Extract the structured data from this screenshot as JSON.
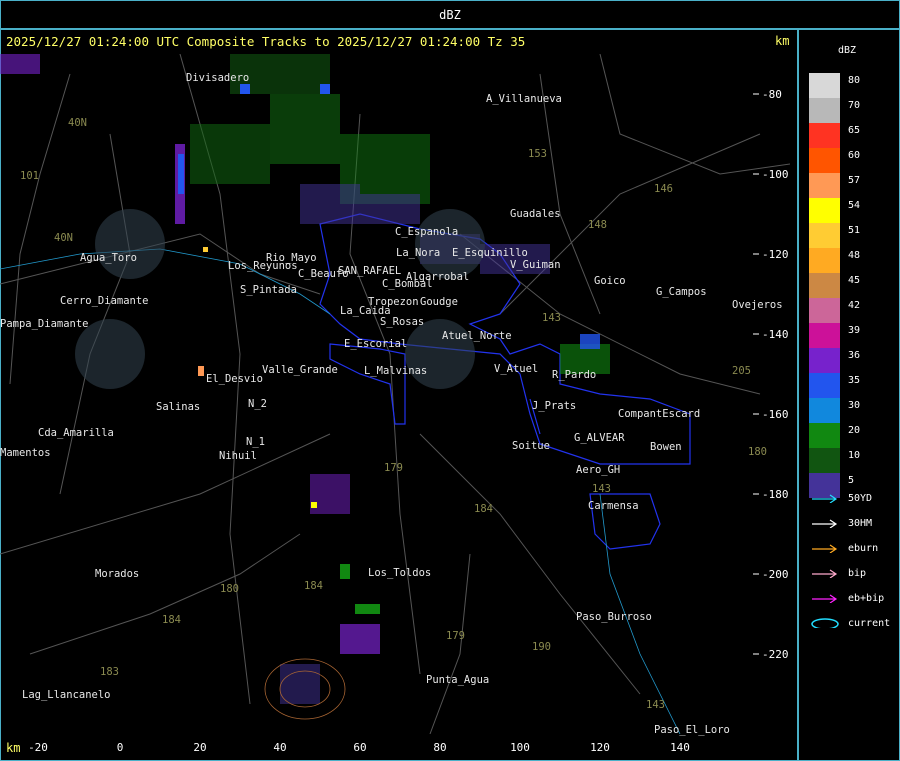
{
  "top_title": "dBZ",
  "header": "2025/12/27 01:24:00 UTC Composite Tracks to 2025/12/27 01:24:00 Tz 35",
  "km_label": "km",
  "x_ticks": [
    "-20",
    "0",
    "20",
    "40",
    "60",
    "80",
    "100",
    "120",
    "140"
  ],
  "y_ticks": [
    "-80",
    "-100",
    "-120",
    "-140",
    "-160",
    "-180",
    "-200",
    "-220"
  ],
  "places": [
    "Divisadero",
    "A_Villanueva",
    "Guadales",
    "C_Espanola",
    "E_Esquinillo",
    "V_Guiman",
    "Goico",
    "G_Campos",
    "Ovejeros",
    "Agua_Toro",
    "Pampa_Diamante",
    "Los_Reyunos",
    "Rio_Mayo",
    "S_Pintada",
    "C_Beaufo",
    "SAN_RAFAEL",
    "Algarrobal",
    "C_Bombal",
    "Tropezon",
    "Goudge",
    "La_Caida",
    "S_Rosas",
    "La_Nora",
    "Atuel_Norte",
    "E_Escorial",
    "Valle_Grande",
    "L_Malvinas",
    "V_Atuel",
    "R_Pardo",
    "El_Desvio",
    "Salinas",
    "N_2",
    "N_1",
    "Nihuil",
    "J_Prats",
    "CompantEscard",
    "G_ALVEAR",
    "Soitue",
    "Bowen",
    "Aero_GH",
    "Carmensa",
    "Cda_Amarilla",
    "Mamentos",
    "Morados",
    "Los_Toldos",
    "Paso_Burroso",
    "Punta_Agua",
    "Lag_Llancanelo",
    "Paso_El_Loro",
    "Cerro_Diamante"
  ],
  "roads": [
    "101",
    "40N",
    "40N",
    "153",
    "146",
    "148",
    "143",
    "205",
    "180",
    "179",
    "184",
    "184",
    "180",
    "184",
    "183",
    "190",
    "143",
    "179",
    "143"
  ],
  "legend": {
    "title": "dBZ",
    "scale": [
      {
        "label": "80",
        "color": "#d8d8d8"
      },
      {
        "label": "70",
        "color": "#b8b8b8"
      },
      {
        "label": "65",
        "color": "#ff3322"
      },
      {
        "label": "60",
        "color": "#ff5500"
      },
      {
        "label": "57",
        "color": "#ff9955"
      },
      {
        "label": "54",
        "color": "#ffff00"
      },
      {
        "label": "51",
        "color": "#ffcc33"
      },
      {
        "label": "48",
        "color": "#ffaa22"
      },
      {
        "label": "45",
        "color": "#cc8844"
      },
      {
        "label": "42",
        "color": "#cc6699"
      },
      {
        "label": "39",
        "color": "#cc1199"
      },
      {
        "label": "36",
        "color": "#7722cc"
      },
      {
        "label": "35",
        "color": "#2255ee"
      },
      {
        "label": "30",
        "color": "#1188dd"
      },
      {
        "label": "20",
        "color": "#118811"
      },
      {
        "label": "10",
        "color": "#115511"
      },
      {
        "label": "5",
        "color": "#443399"
      }
    ],
    "tracks": [
      {
        "label": "50YD",
        "color": "#22ddff"
      },
      {
        "label": "30HM",
        "color": "#ffffff"
      },
      {
        "label": "eburn",
        "color": "#ffaa22"
      },
      {
        "label": "bip",
        "color": "#ffaacc"
      },
      {
        "label": "eb+bip",
        "color": "#ff22ff"
      },
      {
        "label": "current",
        "color": "#22ddff"
      }
    ]
  },
  "colors": {
    "frame": "#4ab0c8",
    "border": "#3344ff",
    "header": "#ffff66"
  }
}
